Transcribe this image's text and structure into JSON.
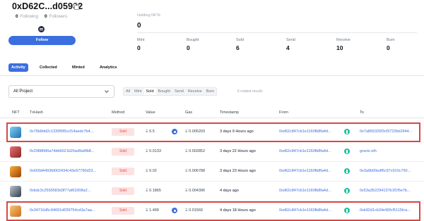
{
  "profile": {
    "address": "0xD62C...d05932",
    "following_count": "0",
    "following_label": "Following",
    "followers_count": "0",
    "followers_label": "Followers",
    "follow_button": "Follow"
  },
  "holdings": {
    "label": "Holding NFTs",
    "value": "0"
  },
  "metrics": [
    {
      "label": "Mint",
      "value": "0"
    },
    {
      "label": "Bought",
      "value": "0"
    },
    {
      "label": "Sold",
      "value": "6"
    },
    {
      "label": "Send",
      "value": "4"
    },
    {
      "label": "Receive",
      "value": "10"
    },
    {
      "label": "Burn",
      "value": "0"
    }
  ],
  "tabs": [
    "Activity",
    "Collected",
    "Minted",
    "Analytics"
  ],
  "filters": {
    "project_select": "All Project",
    "types": [
      "All",
      "Mint",
      "Sold",
      "Bought",
      "Send",
      "Receive",
      "Burn"
    ],
    "active_type": "Sold",
    "results": "6 related results"
  },
  "table": {
    "headers": [
      "NFT",
      "TxHash",
      "Method",
      "Value",
      "Gas",
      "Timestamp",
      "From",
      "To"
    ],
    "rows": [
      {
        "tx": "0x76b8dd2c1339f5f5ccf14aedc7b4...",
        "method": "Sold",
        "value": "Ξ 0.5",
        "gas": "Ξ 0.005203",
        "time": "3 days 9 Hours ago",
        "from": "0xd62c847cb1e1160fb8fa4d...",
        "to": "0x7a855326f3cf3722bb2944...",
        "thumb": "#4aa3d8"
      },
      {
        "tx": "0x2988fbf0a74db6621b26ad9a9fb8...",
        "method": "Sold",
        "value": "Ξ 0.0133",
        "gas": "Ξ 0.002852",
        "time": "3 days 22 Hours ago",
        "from": "0xd62c847cb1e1160fb8fa4d...",
        "to": "gravix.eth",
        "thumb": "#c0392b"
      },
      {
        "tx": "0x669d4493fd002434c43e97790d23...",
        "method": "Sold",
        "value": "Ξ 0.02",
        "gas": "Ξ 0.006788",
        "time": "3 days 23 Hours ago",
        "from": "0xd62c847cb1e1160fb8fa4d...",
        "to": "0x3a9b00edf6c97c910c750...",
        "thumb": "#d35400"
      },
      {
        "tx": "0xbdc3c2559583d3f77af63308a2...",
        "method": "Sold",
        "value": "Ξ 0.1865",
        "gas": "Ξ 0.004396",
        "time": "4 days ago",
        "from": "0xd62c847cb1e1160fb8fa4d...",
        "to": "0x53a352294137b1f1f5e7b...",
        "thumb": "#2c3e50"
      },
      {
        "tx": "0x34716d5c94691df25f754cd3a7aa...",
        "method": "Sold",
        "value": "Ξ 1.499",
        "gas": "Ξ 0.01569",
        "time": "4 days 18 Hours ago",
        "from": "0xd62c847cb1e1160fb8fa4d...",
        "to": "0xb92d1cb34e90fcf5115fca...",
        "thumb": "#e67e22"
      }
    ]
  },
  "colors": {
    "accent": "#3b6fe0",
    "sold_badge": "#ef4444",
    "highlight": "#d94646"
  }
}
